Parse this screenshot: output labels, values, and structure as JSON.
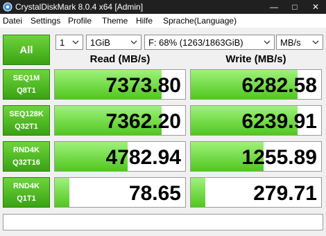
{
  "window": {
    "title": "CrystalDiskMark 8.0.4 x64 [Admin]"
  },
  "menu": [
    "Datei",
    "Settings",
    "Profile",
    "Theme",
    "Hilfe",
    "Sprache(Language)"
  ],
  "controls": {
    "all_label": "All",
    "count": "1",
    "size": "1GiB",
    "drive": "F: 68% (1263/1863GiB)",
    "unit": "MB/s"
  },
  "columns": {
    "read": "Read (MB/s)",
    "write": "Write (MB/s)"
  },
  "tests": [
    {
      "line1": "SEQ1M",
      "line2": "Q8T1",
      "read": "7373.80",
      "write": "6282.58"
    },
    {
      "line1": "SEQ128K",
      "line2": "Q32T1",
      "read": "7362.20",
      "write": "6239.91"
    },
    {
      "line1": "RND4K",
      "line2": "Q32T16",
      "read": "4782.94",
      "write": "1255.89"
    },
    {
      "line1": "RND4K",
      "line2": "Q1T1",
      "read": "78.65",
      "write": "279.71"
    }
  ],
  "bars": {
    "read": [
      0.82,
      0.82,
      0.56,
      0.11
    ],
    "write": [
      0.82,
      0.82,
      0.56,
      0.11
    ]
  },
  "status": {
    "text": ""
  },
  "colors": {
    "accent": "#3aa312",
    "bar": "#52c620"
  }
}
